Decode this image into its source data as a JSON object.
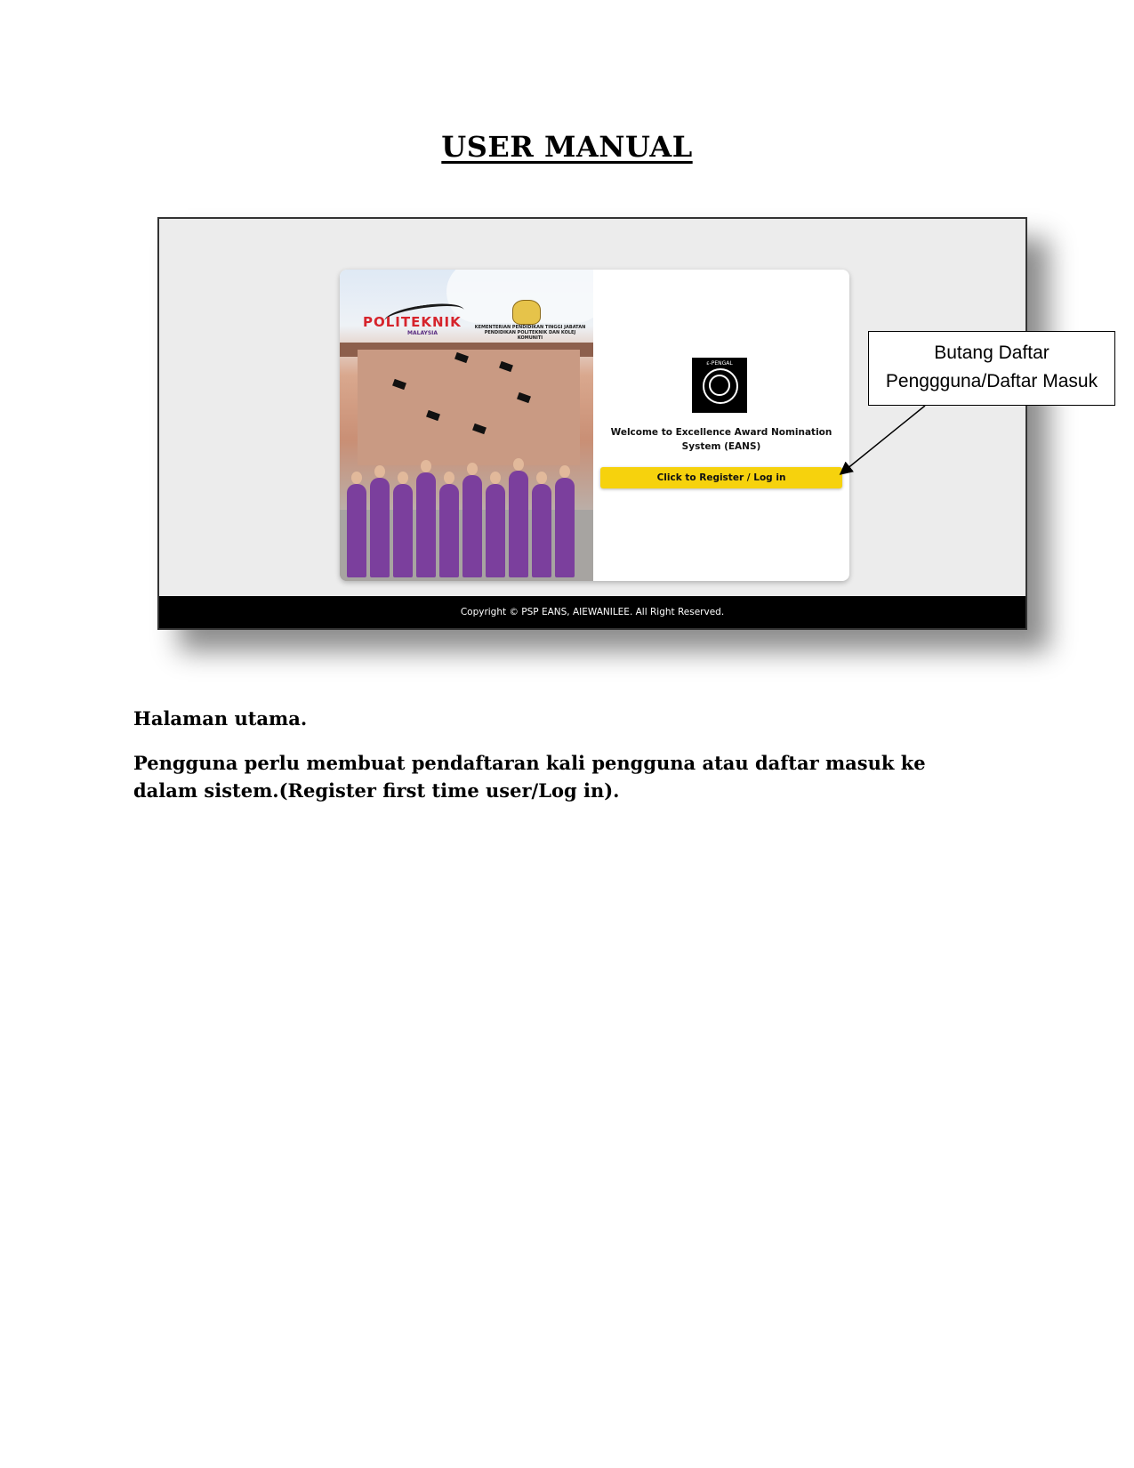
{
  "document": {
    "title": "USER MANUAL"
  },
  "screenshot": {
    "hero": {
      "logo_text": "POLITEKNIK",
      "logo_subtext": "MALAYSIA",
      "ministry_text": "KEMENTERIAN PENDIDIKAN TINGGI JABATAN PENDIDIKAN POLITEKNIK DAN KOLEJ KOMUNITI"
    },
    "system_logo_icon": "eans-logo-icon",
    "welcome_text": "Welcome to Excellence Award Nomination System (EANS)",
    "register_button_label": "Click to Register / Log in",
    "footer_text": "Copyright © PSP EANS, AIEWANILEE. All Right Reserved."
  },
  "callout": {
    "line1": "Butang Daftar",
    "line2": "Penggguna/Daftar Masuk"
  },
  "body": {
    "para1": "Halaman utama.",
    "para2": "Pengguna perlu membuat pendaftaran kali pengguna atau daftar masuk ke dalam sistem.(Register first time user/Log in)."
  },
  "colors": {
    "button_yellow": "#f6d20d",
    "footer_black": "#000000",
    "screenshot_bg": "#ececec"
  }
}
